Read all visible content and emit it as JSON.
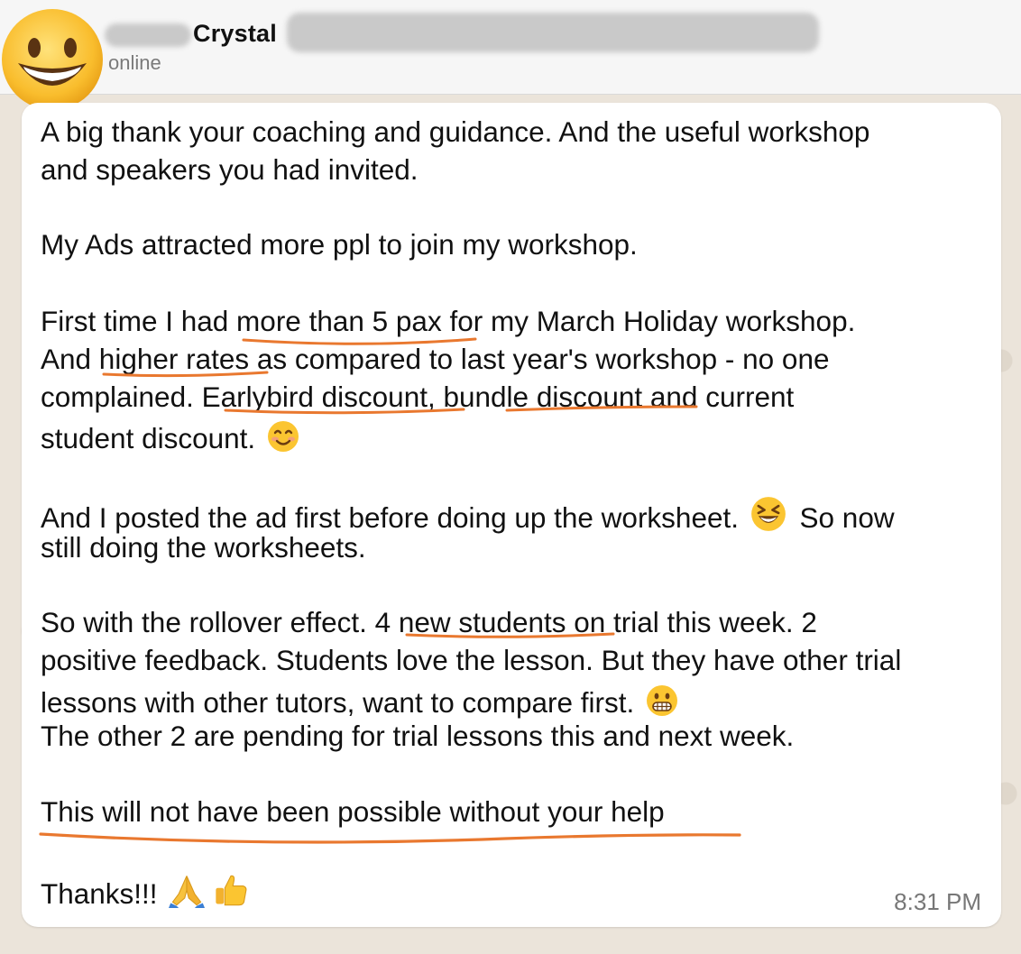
{
  "header": {
    "contact_name": "Crystal",
    "status": "online",
    "avatar_icon": "grinning-face-icon"
  },
  "message": {
    "lines": [
      "A big thank your coaching and guidance. And the useful workshop",
      "and speakers you had invited.",
      "My Ads attracted more ppl to join my workshop.",
      "First time I had more than 5 pax for my March Holiday  workshop.",
      "And higher rates as compared to last year's workshop - no one",
      "complained.  Earlybird discount, bundle discount and current",
      "student discount.",
      "And I posted the ad first before doing up the worksheet.",
      "So now",
      "still doing the worksheets.",
      "So with the rollover effect. 4 new students on trial this week. 2",
      "positive feedback. Students love the lesson. But they have other trial",
      "lessons with other tutors, want to compare first.",
      "The other 2 are pending for trial lessons this and next week.",
      "This will not have been possible without your help",
      "Thanks!!!"
    ],
    "emojis": {
      "smiling": "smiling-face-icon",
      "laughing": "grinning-squinting-face-icon",
      "grimacing": "grimacing-face-icon",
      "folded_hands": "folded-hands-icon",
      "thumbs_up": "thumbs-up-icon"
    },
    "timestamp": "8:31 PM",
    "underline_color": "#e9782f"
  }
}
